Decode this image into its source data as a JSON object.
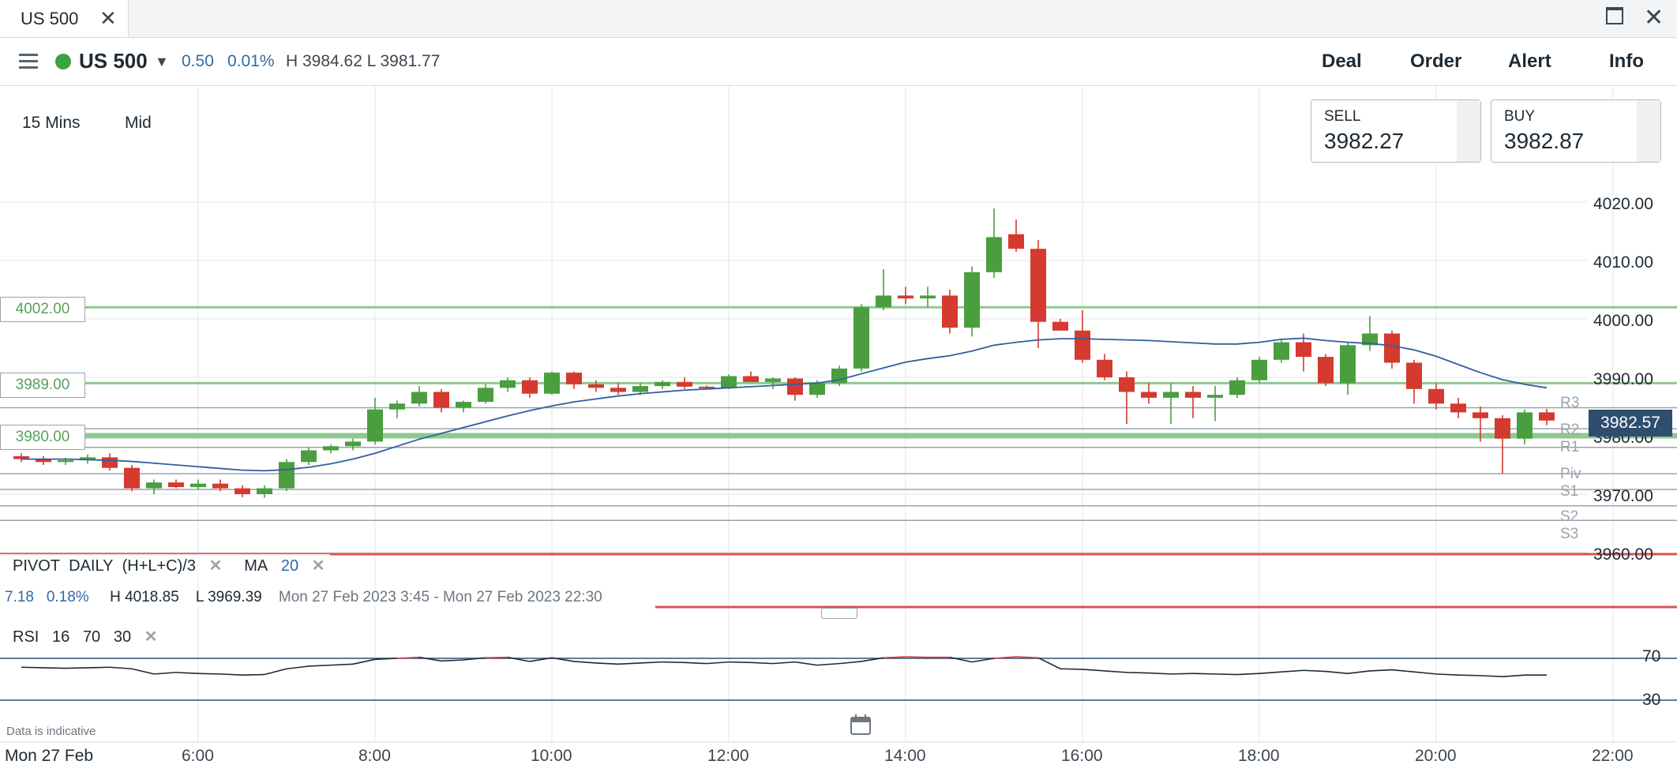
{
  "tab": {
    "title": "US 500",
    "close": "✕"
  },
  "window": {
    "close": "✕"
  },
  "header": {
    "instrument": "US 500",
    "status_color": "#3aa343",
    "change": "0.50",
    "change_pct": "0.01%",
    "high_low": "H 3984.62 L 3981.77",
    "buttons": [
      "Deal",
      "Order",
      "Alert",
      "Info"
    ]
  },
  "chart_controls": {
    "timeframe": "15 Mins",
    "price_type": "Mid"
  },
  "sell": {
    "label": "SELL",
    "value": "3982.27"
  },
  "buy": {
    "label": "BUY",
    "value": "3982.87"
  },
  "y_axis": [
    "4020.00",
    "4010.00",
    "4000.00",
    "3990.00",
    "3980.00",
    "3970.00",
    "3960.00"
  ],
  "x_axis": [
    "6:00",
    "8:00",
    "10:00",
    "12:00",
    "14:00",
    "16:00",
    "18:00",
    "20:00",
    "22:00"
  ],
  "levels": [
    "4002.00",
    "3989.00",
    "3980.00"
  ],
  "pivot_labels": [
    "R3",
    "R2",
    "R1",
    "Piv",
    "S1",
    "S2",
    "S3"
  ],
  "current_price": "3982.57",
  "indicators": {
    "pivot": "PIVOT",
    "pivot_period": "DAILY",
    "pivot_formula": "(H+L+C)/3",
    "ma": "MA",
    "ma_period": "20",
    "remove": "✕"
  },
  "stats": {
    "change": "7.18",
    "change_pct": "0.18%",
    "high": "H 4018.85",
    "low": "L 3969.39",
    "range": "Mon 27 Feb 2023 3:45 - Mon 27 Feb 2023 22:30"
  },
  "rsi": {
    "label": "RSI",
    "period": "16",
    "upper": "70",
    "lower": "30",
    "levels": [
      "70",
      "30"
    ]
  },
  "footer": {
    "indicative": "Data is indicative",
    "date": "Mon 27 Feb"
  },
  "colors": {
    "up": "#4a9e3f",
    "down": "#d43a2f",
    "ma": "#2f5f9e",
    "level_green": "#8fc98f",
    "pivot_gray": "#9aa3ad",
    "rsi_over": "#d43a2f"
  },
  "chart_data": {
    "type": "candlestick",
    "time_start": "3:45",
    "interval": "15 Mins",
    "ohlc": [
      [
        3976.5,
        3977.0,
        3975.5,
        3976.0
      ],
      [
        3976.0,
        3976.5,
        3975.0,
        3975.5
      ],
      [
        3975.5,
        3976.2,
        3975.0,
        3975.8
      ],
      [
        3975.8,
        3976.8,
        3975.2,
        3976.3
      ],
      [
        3976.3,
        3977.0,
        3974.0,
        3974.5
      ],
      [
        3974.5,
        3975.0,
        3970.5,
        3971.0
      ],
      [
        3971.0,
        3972.5,
        3970.0,
        3972.0
      ],
      [
        3972.0,
        3972.5,
        3971.0,
        3971.2
      ],
      [
        3971.2,
        3972.5,
        3970.8,
        3971.8
      ],
      [
        3971.8,
        3972.5,
        3970.5,
        3971.0
      ],
      [
        3971.0,
        3971.5,
        3969.5,
        3970.0
      ],
      [
        3970.0,
        3971.5,
        3969.4,
        3971.0
      ],
      [
        3971.0,
        3976.0,
        3970.5,
        3975.5
      ],
      [
        3975.5,
        3978.0,
        3975.0,
        3977.5
      ],
      [
        3977.5,
        3978.5,
        3977.0,
        3978.2
      ],
      [
        3978.2,
        3979.5,
        3977.5,
        3979.0
      ],
      [
        3979.0,
        3986.5,
        3978.5,
        3984.5
      ],
      [
        3984.5,
        3986.0,
        3983.0,
        3985.5
      ],
      [
        3985.5,
        3988.5,
        3985.0,
        3987.5
      ],
      [
        3987.5,
        3988.0,
        3984.0,
        3984.8
      ],
      [
        3984.8,
        3986.0,
        3984.0,
        3985.8
      ],
      [
        3985.8,
        3988.8,
        3985.5,
        3988.2
      ],
      [
        3988.2,
        3990.0,
        3987.5,
        3989.5
      ],
      [
        3989.5,
        3990.0,
        3986.5,
        3987.2
      ],
      [
        3987.2,
        3991.0,
        3987.0,
        3990.8
      ],
      [
        3990.8,
        3991.0,
        3988.0,
        3988.8
      ],
      [
        3988.8,
        3989.5,
        3987.5,
        3988.2
      ],
      [
        3988.2,
        3989.0,
        3987.0,
        3987.5
      ],
      [
        3987.5,
        3989.0,
        3987.0,
        3988.5
      ],
      [
        3988.5,
        3989.5,
        3988.0,
        3989.2
      ],
      [
        3989.2,
        3990.0,
        3988.0,
        3988.4
      ],
      [
        3988.4,
        3988.6,
        3988.0,
        3988.2
      ],
      [
        3988.2,
        3990.5,
        3988.0,
        3990.2
      ],
      [
        3990.2,
        3991.0,
        3989.5,
        3989.2
      ],
      [
        3989.2,
        3990.0,
        3988.0,
        3989.8
      ],
      [
        3989.8,
        3990.0,
        3986.0,
        3987.0
      ],
      [
        3987.0,
        3989.5,
        3986.5,
        3989.0
      ],
      [
        3989.0,
        3992.0,
        3988.5,
        3991.5
      ],
      [
        3991.5,
        4002.5,
        3991.0,
        4002.0
      ],
      [
        4002.0,
        4008.5,
        4001.5,
        4004.0
      ],
      [
        4004.0,
        4005.5,
        4002.5,
        4003.5
      ],
      [
        4003.5,
        4005.5,
        4002.0,
        4004.0
      ],
      [
        4004.0,
        4005.0,
        3997.5,
        3998.5
      ],
      [
        3998.5,
        4009.0,
        3997.0,
        4008.0
      ],
      [
        4008.0,
        4018.9,
        4007.0,
        4014.0
      ],
      [
        4014.5,
        4017.0,
        4011.5,
        4012.0
      ],
      [
        4012.0,
        4013.5,
        3995.0,
        3999.5
      ],
      [
        3999.5,
        4000.0,
        3998.0,
        3998.0
      ],
      [
        3998.0,
        4001.5,
        3992.5,
        3993.0
      ],
      [
        3993.0,
        3994.0,
        3989.5,
        3990.0
      ],
      [
        3990.0,
        3991.0,
        3982.0,
        3987.5
      ],
      [
        3987.5,
        3989.0,
        3985.5,
        3986.5
      ],
      [
        3986.5,
        3989.0,
        3982.0,
        3987.5
      ],
      [
        3987.5,
        3988.5,
        3983.0,
        3986.5
      ],
      [
        3986.5,
        3988.5,
        3982.5,
        3987.0
      ],
      [
        3987.0,
        3990.0,
        3986.5,
        3989.5
      ],
      [
        3989.5,
        3993.5,
        3989.0,
        3993.0
      ],
      [
        3993.0,
        3996.5,
        3992.5,
        3996.0
      ],
      [
        3996.0,
        3997.5,
        3991.0,
        3993.5
      ],
      [
        3993.5,
        3994.0,
        3988.5,
        3989.0
      ],
      [
        3989.0,
        3996.0,
        3987.0,
        3995.5
      ],
      [
        3995.5,
        4000.5,
        3994.5,
        3997.5
      ],
      [
        3997.5,
        3998.0,
        3991.5,
        3992.5
      ],
      [
        3992.5,
        3993.0,
        3985.5,
        3988.0
      ],
      [
        3988.0,
        3989.0,
        3984.5,
        3985.5
      ],
      [
        3985.5,
        3986.5,
        3983.0,
        3984.0
      ],
      [
        3984.0,
        3985.0,
        3979.0,
        3983.0
      ],
      [
        3983.0,
        3983.5,
        3973.5,
        3979.5
      ],
      [
        3979.5,
        3984.5,
        3978.5,
        3984.0
      ],
      [
        3984.0,
        3984.6,
        3981.8,
        3982.6
      ]
    ],
    "ma20": [
      3976.0,
      3976.0,
      3976.0,
      3975.9,
      3975.8,
      3975.6,
      3975.3,
      3975.0,
      3974.7,
      3974.4,
      3974.1,
      3974.0,
      3974.2,
      3974.6,
      3975.2,
      3976.0,
      3977.0,
      3978.2,
      3979.4,
      3980.4,
      3981.4,
      3982.4,
      3983.4,
      3984.3,
      3985.1,
      3985.8,
      3986.3,
      3986.8,
      3987.2,
      3987.5,
      3987.8,
      3988.0,
      3988.2,
      3988.4,
      3988.6,
      3988.8,
      3989.0,
      3989.6,
      3990.6,
      3991.6,
      3992.6,
      3993.2,
      3993.7,
      3994.5,
      3995.5,
      3996.0,
      3996.4,
      3996.6,
      3996.6,
      3996.5,
      3996.4,
      3996.3,
      3996.1,
      3995.9,
      3995.7,
      3995.7,
      3996.0,
      3996.5,
      3996.7,
      3996.3,
      3996.0,
      3995.8,
      3995.4,
      3994.7,
      3993.6,
      3992.2,
      3990.8,
      3989.6,
      3988.8,
      3988.2
    ],
    "rsi": [
      61.5,
      61.0,
      60.5,
      61.0,
      61.5,
      60.0,
      55.0,
      56.5,
      55.5,
      55.0,
      54.0,
      54.5,
      60.0,
      62.5,
      63.5,
      64.5,
      69.0,
      70.0,
      71.0,
      67.5,
      68.5,
      70.5,
      71.0,
      67.0,
      70.5,
      67.0,
      65.5,
      64.5,
      65.5,
      66.5,
      66.0,
      65.0,
      66.5,
      66.0,
      65.0,
      66.5,
      63.5,
      65.0,
      67.0,
      70.5,
      71.5,
      71.0,
      71.0,
      66.5,
      70.0,
      71.5,
      70.5,
      60.0,
      59.5,
      58.0,
      56.5,
      56.0,
      55.0,
      55.5,
      55.0,
      54.5,
      55.5,
      57.0,
      58.5,
      57.5,
      55.5,
      58.0,
      59.0,
      57.0,
      55.0,
      54.0,
      53.5,
      52.5,
      54.0,
      54.0
    ],
    "levels": [
      4002.0,
      3989.0,
      3980.0
    ],
    "y_range": [
      3960,
      4020
    ],
    "rsi_levels": [
      70,
      30
    ]
  }
}
